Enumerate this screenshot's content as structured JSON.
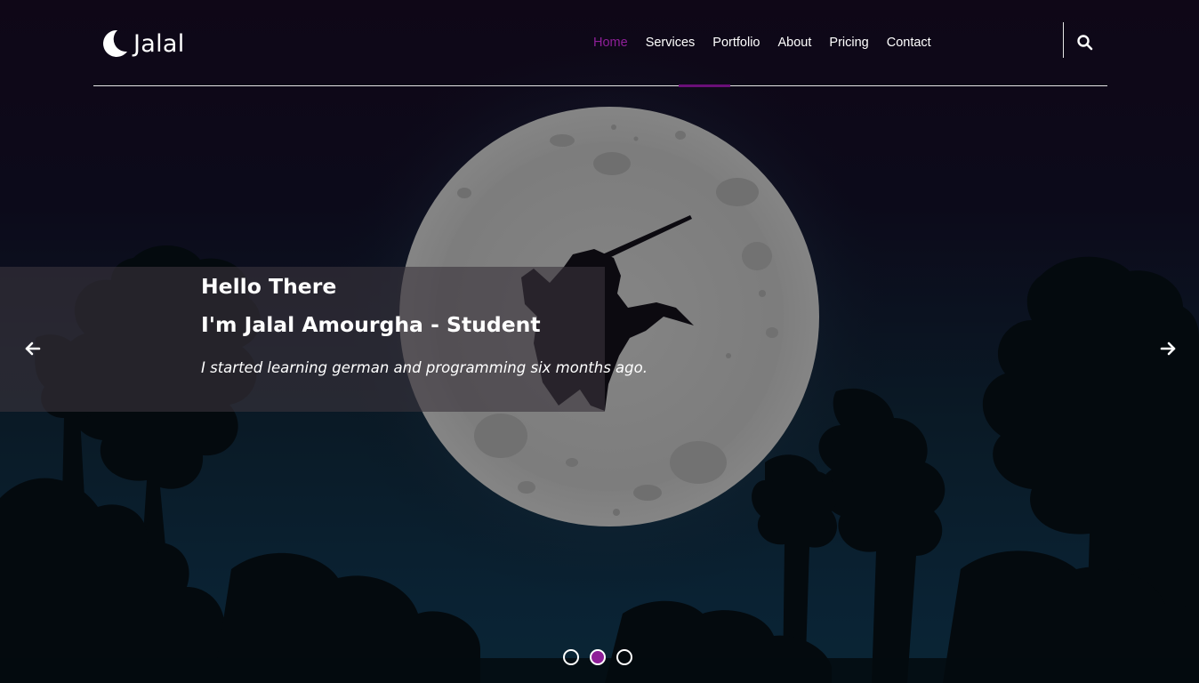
{
  "brand": {
    "name": "Jalal",
    "icon": "crescent-moon-icon"
  },
  "nav": {
    "items": [
      {
        "label": "Home",
        "active": true
      },
      {
        "label": "Services",
        "active": false
      },
      {
        "label": "Portfolio",
        "active": false
      },
      {
        "label": "About",
        "active": false
      },
      {
        "label": "Pricing",
        "active": false
      },
      {
        "label": "Contact",
        "active": false
      }
    ],
    "search_icon": "search-icon"
  },
  "hero": {
    "title_line1": "Hello There",
    "title_line2": "I'm Jalal Amourgha - Student",
    "text": "I started learning german and programming six months ago.",
    "prev_icon": "arrow-left-icon",
    "next_icon": "arrow-right-icon",
    "slides_total": 3,
    "active_slide": 2
  },
  "colors": {
    "accent": "#8e1f98",
    "accent_dark": "#6a0f78",
    "header_bg": "#0f0717",
    "text": "#ffffff",
    "moon": "#7d7d7d"
  }
}
